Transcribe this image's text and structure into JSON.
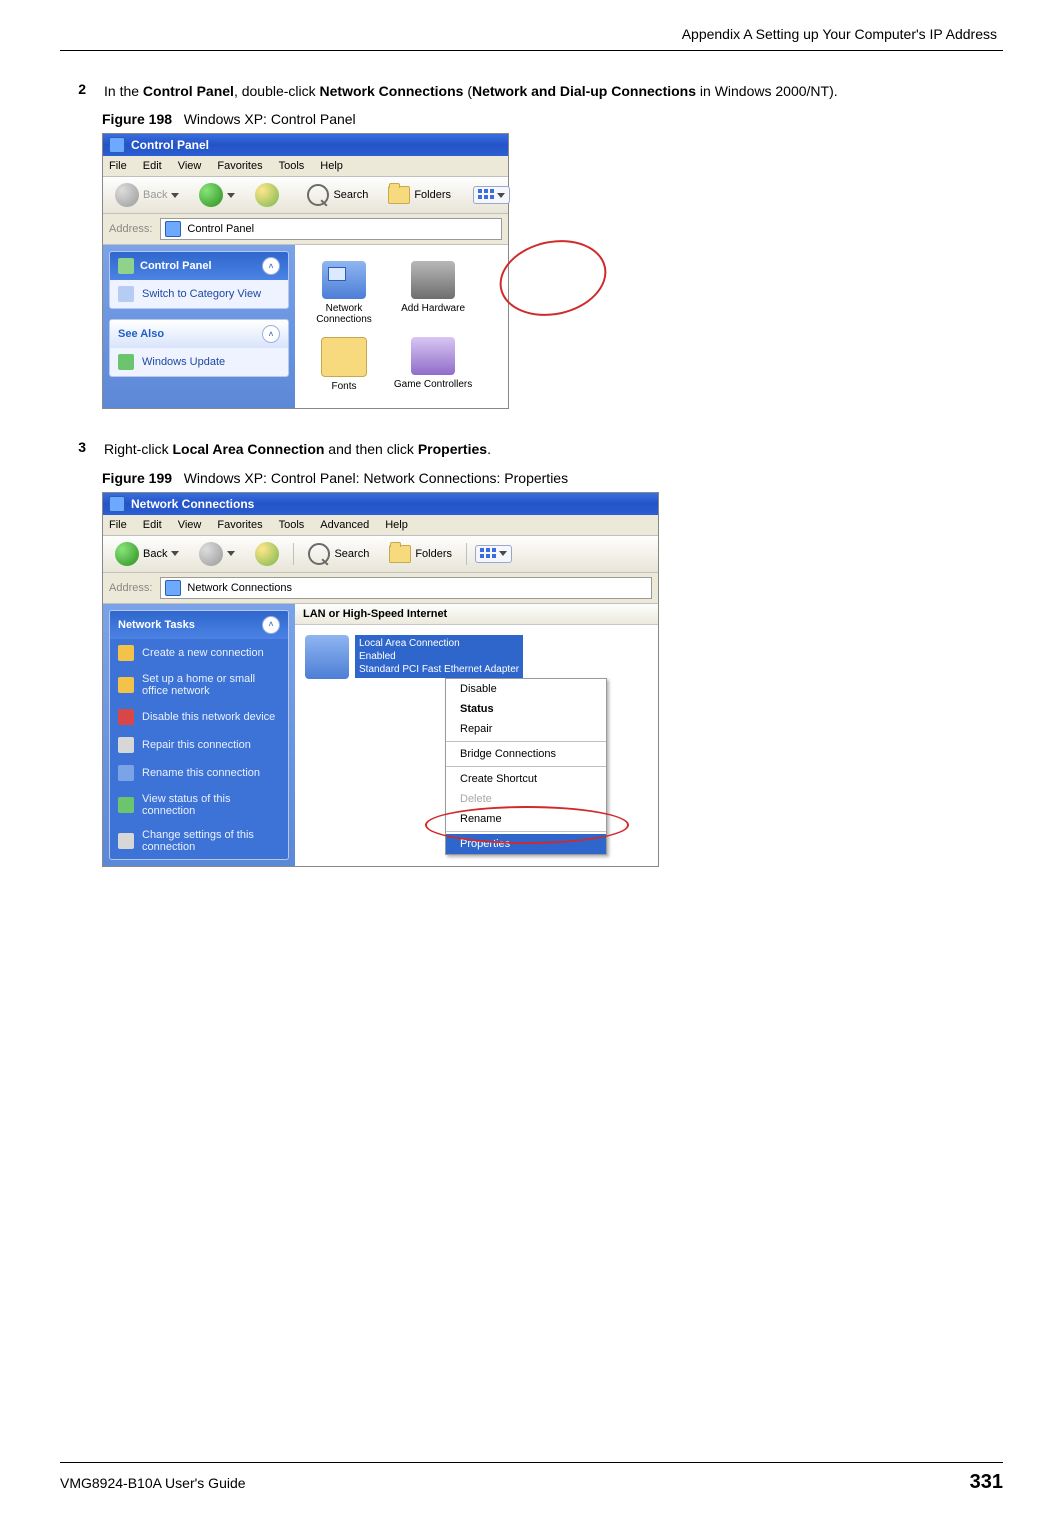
{
  "header": {
    "title": "Appendix A Setting up Your Computer's IP Address"
  },
  "steps": {
    "2": {
      "num": "2",
      "t1": "In the ",
      "b1": "Control Panel",
      "t2": ", double-click ",
      "b2": "Network Connections",
      "t3": " (",
      "b3": "Network and Dial-up Connections",
      "t4": " in Windows 2000/NT)."
    },
    "3": {
      "num": "3",
      "t1": "Right-click ",
      "b1": "Local Area Connection",
      "t2": " and then click ",
      "b2": "Properties",
      "t3": "."
    }
  },
  "fig198": {
    "label": "Figure 198",
    "caption": "Windows XP: Control Panel"
  },
  "fig199": {
    "label": "Figure 199",
    "caption": "Windows XP: Control Panel: Network Connections: Properties"
  },
  "cp": {
    "title": "Control Panel",
    "menu": {
      "file": "File",
      "edit": "Edit",
      "view": "View",
      "fav": "Favorites",
      "tools": "Tools",
      "help": "Help"
    },
    "tb": {
      "back": "Back",
      "search": "Search",
      "folders": "Folders"
    },
    "addrlabel": "Address:",
    "addr": "Control Panel",
    "box1": {
      "title": "Control Panel",
      "item": "Switch to Category View"
    },
    "box2": {
      "title": "See Also",
      "item": "Windows Update"
    },
    "icons": {
      "net": "Network Connections",
      "hw": "Add Hardware",
      "fonts": "Fonts",
      "game": "Game Controllers"
    }
  },
  "nc": {
    "title": "Network Connections",
    "menu": {
      "file": "File",
      "edit": "Edit",
      "view": "View",
      "fav": "Favorites",
      "tools": "Tools",
      "adv": "Advanced",
      "help": "Help"
    },
    "tb": {
      "back": "Back",
      "search": "Search",
      "folders": "Folders"
    },
    "addrlabel": "Address:",
    "addr": "Network Connections",
    "tasks": {
      "title": "Network Tasks",
      "i1": "Create a new connection",
      "i2": "Set up a home or small office network",
      "i3": "Disable this network device",
      "i4": "Repair this connection",
      "i5": "Rename this connection",
      "i6": "View status of this connection",
      "i7": "Change settings of this connection"
    },
    "section": "LAN or High-Speed Internet",
    "conn": {
      "name": "Local Area Connection",
      "state": "Enabled",
      "dev": "Standard PCI Fast Ethernet Adapter"
    },
    "menuitems": {
      "disable": "Disable",
      "status": "Status",
      "repair": "Repair",
      "bridge": "Bridge Connections",
      "shortcut": "Create Shortcut",
      "delete": "Delete",
      "rename": "Rename",
      "properties": "Properties"
    }
  },
  "footer": {
    "guide": "VMG8924-B10A User's Guide",
    "page": "331"
  }
}
